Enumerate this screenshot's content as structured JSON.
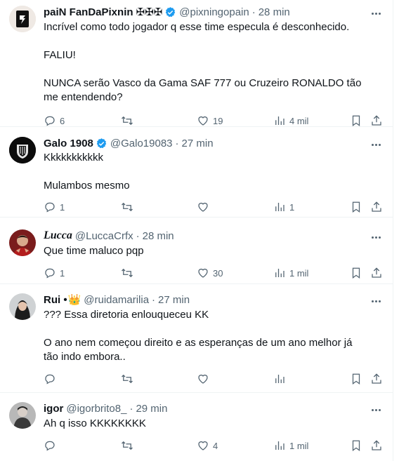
{
  "tweets": [
    {
      "name": "paiN FanDaPixnin",
      "name_suffix": "✠✠✠",
      "verified": true,
      "handle": "@pixningopain",
      "time": "28 min",
      "text": "Incrível como todo jogador q esse time especula é desconhecido.\n\nFALIU!\n\nNUNCA serão Vasco da Gama SAF 777 ou Cruzeiro RONALDO tão me entendendo?",
      "replies": "6",
      "retweets": "",
      "likes": "19",
      "views": "4 mil"
    },
    {
      "name": "Galo 1908",
      "name_suffix": "",
      "verified": true,
      "handle": "@Galo19083",
      "time": "27 min",
      "text": "Kkkkkkkkkkk\n\nMulambos mesmo",
      "replies": "1",
      "retweets": "",
      "likes": "",
      "views": "1"
    },
    {
      "name": "Lucca",
      "name_suffix": "",
      "verified": false,
      "handle": "@LuccaCrfx",
      "time": "28 min",
      "text": "Que time maluco pqp",
      "replies": "1",
      "retweets": "",
      "likes": "30",
      "views": "1 mil"
    },
    {
      "name": "Rui •",
      "name_suffix": "👑",
      "verified": false,
      "handle": "@ruidamarilia",
      "time": "27 min",
      "text": "??? Essa diretoria enlouqueceu KK\n\nO ano nem começou direito e as esperanças de um ano melhor já tão indo embora..",
      "replies": "",
      "retweets": "",
      "likes": "",
      "views": ""
    },
    {
      "name": "igor",
      "name_suffix": "",
      "verified": false,
      "handle": "@igorbrito8_",
      "time": "29 min",
      "text": "Ah q isso KKKKKKKK",
      "replies": "",
      "retweets": "",
      "likes": "4",
      "views": "1 mil"
    }
  ],
  "colors": {
    "text": "#0f1419",
    "muted": "#536471",
    "verified": "#1d9bf0",
    "divider": "#eff3f4"
  }
}
